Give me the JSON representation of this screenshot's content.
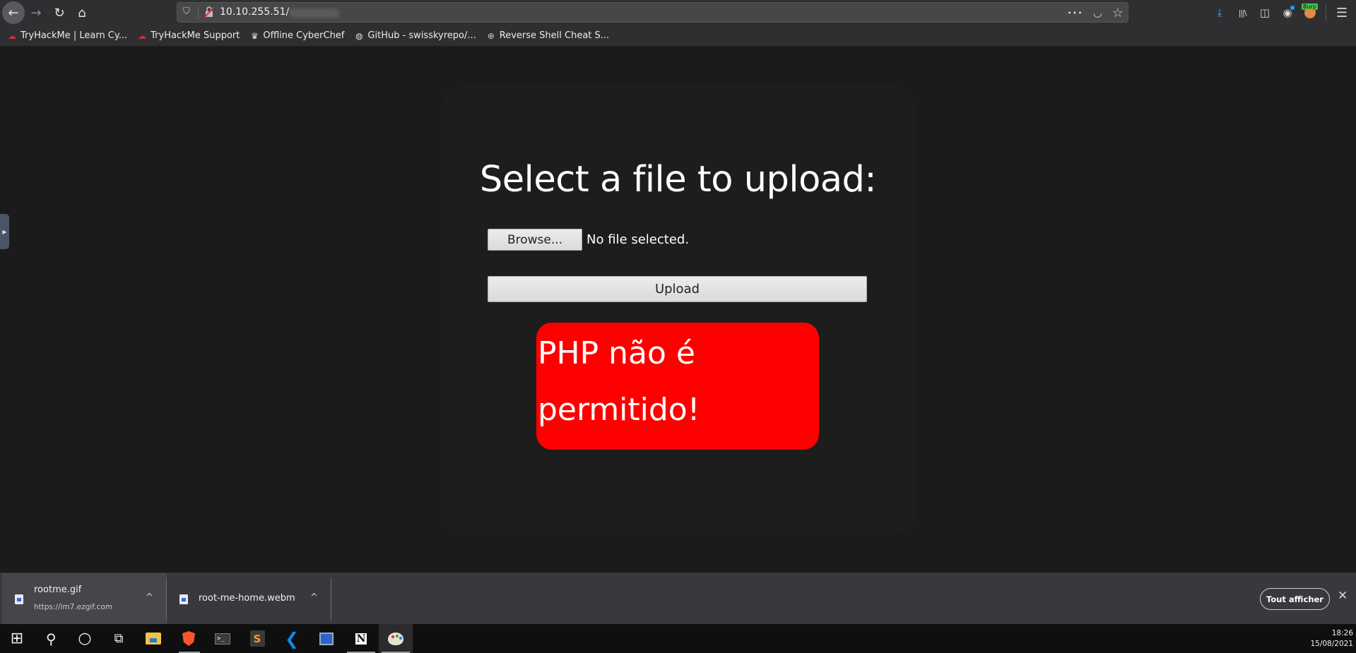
{
  "browser": {
    "url_host": "10.10.255.51/",
    "url_path_redacted": true,
    "nav_icons": [
      "back-icon",
      "forward-icon",
      "reload-icon",
      "home-icon"
    ],
    "url_icons": [
      "tracking-shield-icon",
      "insecure-lock-icon"
    ],
    "url_actions": [
      "page-actions-icon",
      "pocket-icon",
      "bookmark-star-icon"
    ],
    "toolbar_icons": [
      "downloads-icon",
      "library-icon",
      "sidebar-icon",
      "account-icon",
      "burp-extension-icon",
      "menu-icon"
    ],
    "burp_badge": "Burp",
    "glyphs": {
      "back": "←",
      "forward": "→",
      "reload": "↻",
      "home": "⌂",
      "shield": "⛉",
      "more": "•••",
      "pocket": "◡",
      "star": "☆",
      "download": "⤓",
      "library": "|||\\",
      "sidebar": "◫",
      "account": "◉",
      "menu": "☰"
    }
  },
  "bookmarks": [
    {
      "label": "TryHackMe | Learn Cy...",
      "icon": "cloud-icon",
      "glyph": "☁"
    },
    {
      "label": "TryHackMe Support",
      "icon": "cloud-icon",
      "glyph": "☁"
    },
    {
      "label": "Offline CyberChef",
      "icon": "chef-hat-icon",
      "glyph": "♛"
    },
    {
      "label": "GitHub - swisskyrepo/...",
      "icon": "github-icon",
      "glyph": "◍"
    },
    {
      "label": "Reverse Shell Cheat S...",
      "icon": "globe-icon",
      "glyph": "⊕"
    }
  ],
  "page": {
    "heading": "Select a file to upload:",
    "browse_label": "Browse...",
    "file_status": "No file selected.",
    "upload_label": "Upload",
    "error_message": "PHP não é permitido!",
    "colors": {
      "background": "#1b1b1b",
      "card": "#1d1d1d",
      "error": "#ff0000",
      "text": "#ffffff"
    }
  },
  "sidebar_handle": {
    "glyph": "▶"
  },
  "downloads": {
    "items": [
      {
        "name": "rootme.gif",
        "source": "https://im7.ezgif.com"
      },
      {
        "name": "root-me-home.webm",
        "source": ""
      }
    ],
    "chevron": "^",
    "show_all_label": "Tout afficher",
    "close_glyph": "✕"
  },
  "taskbar": {
    "apps": [
      "start-icon",
      "search-icon",
      "cortana-icon",
      "task-view-icon",
      "file-explorer-icon",
      "brave-icon",
      "terminal-icon",
      "sublime-text-icon",
      "vscode-icon",
      "remote-desktop-icon",
      "notion-icon",
      "paint-icon"
    ],
    "glyphs": {
      "start": "⊞",
      "search": "⚲",
      "cortana": "○",
      "taskview": "⧉",
      "terminal": ">_",
      "sublime": "S",
      "vscode": "❮",
      "notion": "N"
    },
    "time": "18:26",
    "date": "15/08/2021"
  }
}
